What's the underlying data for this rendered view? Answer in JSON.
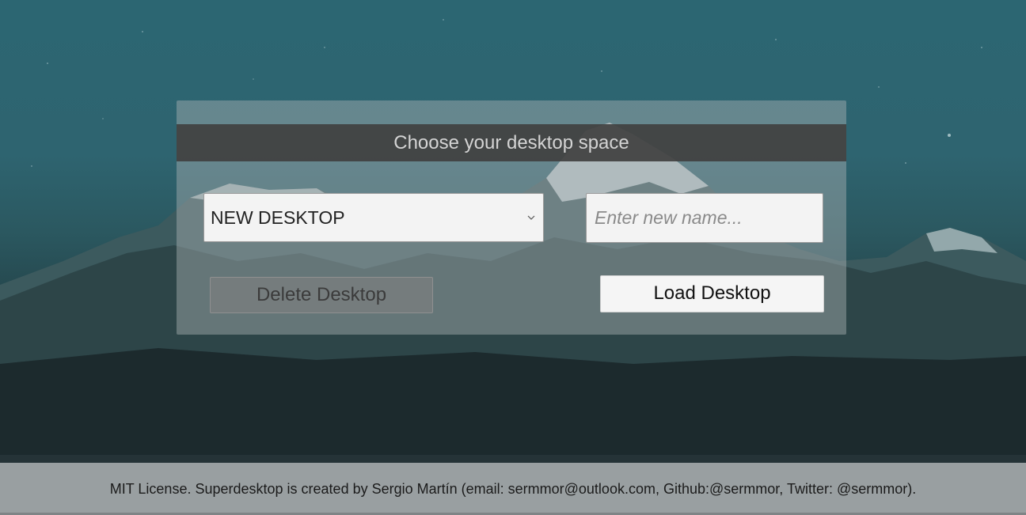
{
  "panel": {
    "title": "Choose your desktop space",
    "desktop_select": {
      "selected_value": "NEW DESKTOP"
    },
    "name_input": {
      "value": "",
      "placeholder": "Enter new name..."
    },
    "delete_button_label": "Delete Desktop",
    "load_button_label": "Load Desktop"
  },
  "footer": {
    "text": "MIT License. Superdesktop is created by Sergio Martín (email: sermmor@outlook.com, Github:@sermmor, Twitter: @sermmor)."
  },
  "background": {
    "description_icon": "mountain-landscape-background",
    "sky_color": "#2c6672",
    "ground_color": "#1a2528"
  },
  "colors": {
    "header_bg": "#404040",
    "header_text": "#d4d4d4",
    "panel_bg": "#aab2b4",
    "footer_bg": "#aaaeb0"
  }
}
